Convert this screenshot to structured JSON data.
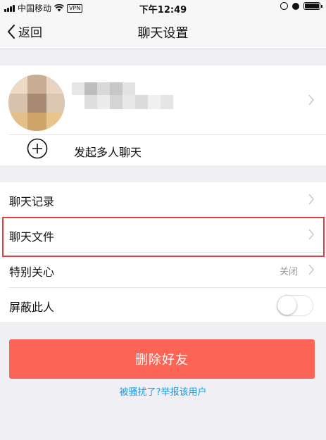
{
  "status_bar": {
    "carrier": "中国移动",
    "vpn": "VPN",
    "time": "下午12:49"
  },
  "nav": {
    "back_label": "返回",
    "title": "聊天设置"
  },
  "profile": {
    "add_chat_label": "发起多人聊天"
  },
  "settings": {
    "items": [
      {
        "label": "聊天记录"
      },
      {
        "label": "聊天文件"
      },
      {
        "label": "特别关心",
        "value": "关闭"
      },
      {
        "label": "屏蔽此人",
        "toggle_on": false
      }
    ]
  },
  "actions": {
    "delete_label": "删除好友",
    "report_label": "被骚扰了?举报该用户"
  },
  "colors": {
    "accent_red": "#fc6456",
    "link_blue": "#1e9be0",
    "highlight_border": "#e24040"
  }
}
